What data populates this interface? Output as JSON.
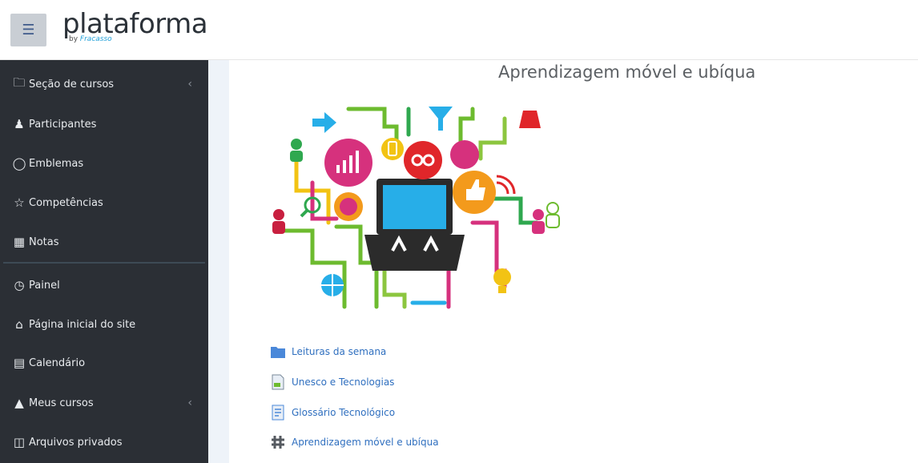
{
  "header": {
    "logo_text": "plataforma",
    "logo_sub_prefix": "by",
    "logo_sub_brand": "Fracasso"
  },
  "sidebar": {
    "items": [
      {
        "label": "Seção de cursos",
        "icon": "folder-icon"
      },
      {
        "label": "Participantes",
        "icon": "users-icon"
      },
      {
        "label": "Emblemas",
        "icon": "badge-icon"
      },
      {
        "label": "Competências",
        "icon": "star-icon"
      },
      {
        "label": "Notas",
        "icon": "grades-icon"
      },
      {
        "label": "Painel",
        "icon": "dashboard-icon"
      },
      {
        "label": "Página inicial do site",
        "icon": "home-icon"
      },
      {
        "label": "Calendário",
        "icon": "calendar-icon"
      },
      {
        "label": "Meus cursos",
        "icon": "graduation-cap-icon"
      },
      {
        "label": "Arquivos privados",
        "icon": "file-icon"
      }
    ]
  },
  "main": {
    "title": "Aprendizagem móvel e ubíqua",
    "activities": [
      {
        "label": "Leituras da semana",
        "icon": "folder-icon"
      },
      {
        "label": "Unesco e Tecnologias",
        "icon": "pdf-document-icon"
      },
      {
        "label": "Glossário Tecnológico",
        "icon": "glossary-icon"
      },
      {
        "label": "Aprendizagem móvel e ubíqua",
        "icon": "forum-icon"
      }
    ]
  },
  "colors": {
    "sidebar_bg": "#2b2f35",
    "link": "#2f6fbf",
    "accent_pink": "#d6317d",
    "accent_green": "#6dbb2f",
    "accent_orange": "#f39a1c",
    "accent_red": "#e0262a",
    "accent_blue": "#27aee8"
  }
}
